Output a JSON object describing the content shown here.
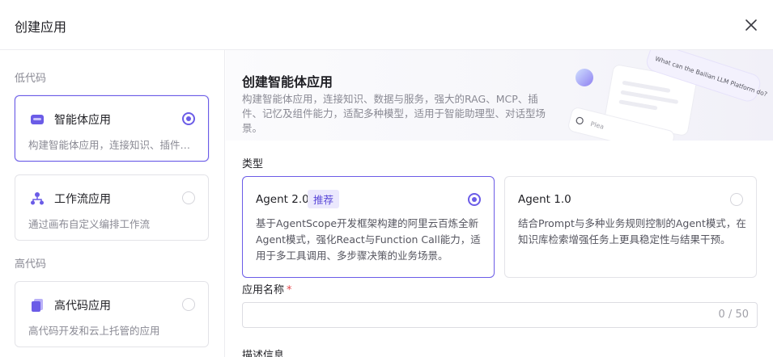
{
  "dialog": {
    "title": "创建应用",
    "close_icon": "close-icon"
  },
  "sidebar": {
    "sections": [
      {
        "label": "低代码"
      },
      {
        "label": "高代码"
      }
    ],
    "apps": [
      {
        "name": "智能体应用",
        "desc": "构建智能体应用，连接知识、插件…",
        "icon": "agent-app-icon",
        "selected": true
      },
      {
        "name": "工作流应用",
        "desc": "通过画布自定义编排工作流",
        "icon": "workflow-icon",
        "selected": false
      },
      {
        "name": "高代码应用",
        "desc": "高代码开发和云上托管的应用",
        "icon": "code-app-icon",
        "selected": false
      }
    ]
  },
  "banner": {
    "title": "创建智能体应用",
    "desc": "构建智能体应用，连接知识、数据与服务，强大的RAG、MCP、插件、记忆及组件能力，适配多种模型，适用于智能助理型、对话型场景。",
    "illustration_text": "What can the Bailian LLM Platform do?",
    "illustration_placeholder": "Plea"
  },
  "type": {
    "label": "类型",
    "options": [
      {
        "name": "Agent 2.0",
        "tag": "推荐",
        "desc": "基于AgentScope开发框架构建的阿里云百炼全新Agent模式，强化React与Function Call能力，适用于多工具调用、多步骤决策的业务场景。",
        "selected": true
      },
      {
        "name": "Agent 1.0",
        "desc": "结合Prompt与多种业务规则控制的Agent模式，在知识库检索增强任务上更具稳定性与结果干预。",
        "selected": false
      }
    ]
  },
  "app_name": {
    "label": "应用名称",
    "required_mark": "*",
    "value": "",
    "placeholder": "",
    "counter": "0 / 50"
  },
  "description": {
    "label": "描述信息"
  },
  "colors": {
    "accent": "#6b5ce7",
    "tag_bg": "#ebe8fd",
    "required": "#e5484d"
  }
}
